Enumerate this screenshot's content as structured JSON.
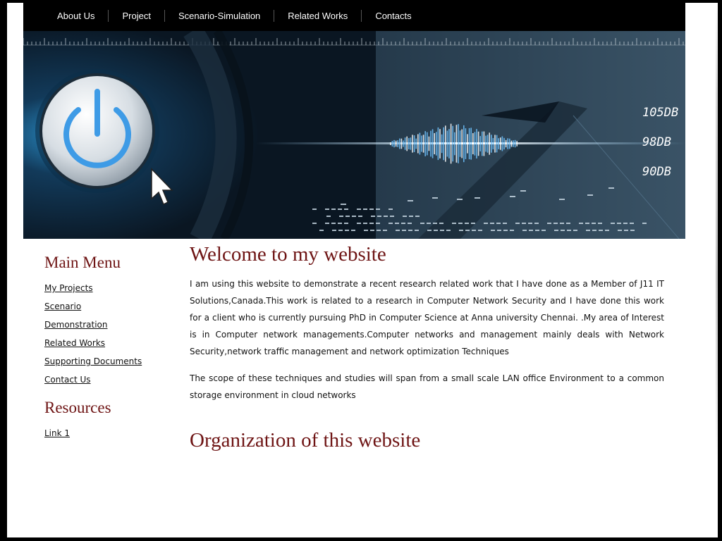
{
  "nav": {
    "items": [
      {
        "label": "About Us"
      },
      {
        "label": "Project"
      },
      {
        "label": "Scenario-Simulation"
      },
      {
        "label": "Related Works"
      },
      {
        "label": "Contacts"
      }
    ]
  },
  "banner": {
    "readouts": [
      "105DB",
      "98DB",
      "90DB"
    ],
    "colors": {
      "accent": "#4aa3ef",
      "dark": "#0c1a28"
    }
  },
  "sidebar": {
    "main_menu_title": "Main Menu",
    "main_menu": [
      {
        "label": "My Projects"
      },
      {
        "label": "Scenario"
      },
      {
        "label": "Demonstration"
      },
      {
        "label": "Related Works"
      },
      {
        "label": "Supporting Documents"
      },
      {
        "label": "Contact Us"
      }
    ],
    "resources_title": "Resources",
    "resources": [
      {
        "label": "Link 1"
      }
    ]
  },
  "main": {
    "heading": "Welcome to my website",
    "para1": "I am using this website to demonstrate a recent research related work that I have done as a Member of J11 IT Solutions,Canada.This work is related to a research in Computer Network Security and I have done this work for a client who is currently pursuing PhD in Computer Science at Anna university Chennai. .My area of Interest is in Computer network managements.Computer networks and management mainly deals with Network Security,network traffic management and network optimization Techniques",
    "para2": "The scope of these techniques and studies will span from a small scale LAN office Environment to a common storage environment in cloud networks",
    "heading2": "Organization of this website"
  },
  "colors": {
    "heading": "#6e1414",
    "nav_bg": "#000000",
    "page_bg": "#ffffff"
  }
}
